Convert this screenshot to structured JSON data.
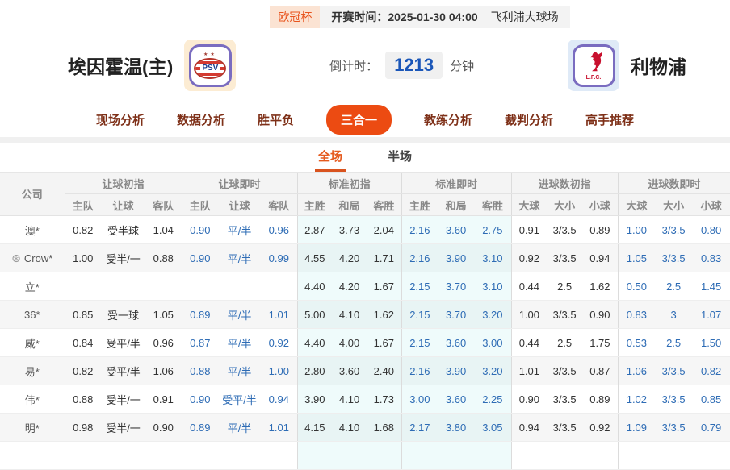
{
  "meta": {
    "league": "欧冠杯",
    "kickoff_label": "开赛时间：",
    "kickoff_time": "2025-01-30 04:00",
    "venue": "飞利浦大球场"
  },
  "header": {
    "home_team": "埃因霍温(主)",
    "away_team": "利物浦",
    "home_logo_text": "PSV",
    "home_logo_stars": "★★",
    "away_logo_text": "L.F.C.",
    "countdown_label": "倒计时：",
    "countdown_value": "1213",
    "countdown_unit": "分钟"
  },
  "nav": {
    "tabs": [
      {
        "label": "现场分析",
        "active": false
      },
      {
        "label": "数据分析",
        "active": false
      },
      {
        "label": "胜平负",
        "active": false
      },
      {
        "label": "三合一",
        "active": true
      },
      {
        "label": "教练分析",
        "active": false
      },
      {
        "label": "裁判分析",
        "active": false
      },
      {
        "label": "高手推荐",
        "active": false
      }
    ]
  },
  "subtabs": [
    {
      "label": "全场",
      "active": true
    },
    {
      "label": "半场",
      "active": false
    }
  ],
  "colors": {
    "accent_orange": "#ec4b12",
    "odds_blue": "#2e6cb5",
    "countdown_blue": "#1a56b8",
    "cyan_column_bg": "#effbfb",
    "badge_orange_text": "#e8541e"
  },
  "table": {
    "company_header": "公司",
    "groups": [
      {
        "label": "让球初指",
        "cols": [
          "主队",
          "让球",
          "客队"
        ],
        "blue": false,
        "cyan": false
      },
      {
        "label": "让球即时",
        "cols": [
          "主队",
          "让球",
          "客队"
        ],
        "blue": true,
        "cyan": false
      },
      {
        "label": "标准初指",
        "cols": [
          "主胜",
          "和局",
          "客胜"
        ],
        "blue": false,
        "cyan": true
      },
      {
        "label": "标准即时",
        "cols": [
          "主胜",
          "和局",
          "客胜"
        ],
        "blue": true,
        "cyan": true
      },
      {
        "label": "进球数初指",
        "cols": [
          "大球",
          "大小",
          "小球"
        ],
        "blue": false,
        "cyan": false
      },
      {
        "label": "进球数即时",
        "cols": [
          "大球",
          "大小",
          "小球"
        ],
        "blue": true,
        "cyan": false
      }
    ],
    "rows": [
      {
        "company": "澳*",
        "has_icon": false,
        "values": [
          [
            "0.82",
            "受半球",
            "1.04"
          ],
          [
            "0.90",
            "平/半",
            "0.96"
          ],
          [
            "2.87",
            "3.73",
            "2.04"
          ],
          [
            "2.16",
            "3.60",
            "2.75"
          ],
          [
            "0.91",
            "3/3.5",
            "0.89"
          ],
          [
            "1.00",
            "3/3.5",
            "0.80"
          ]
        ]
      },
      {
        "company": "Crow*",
        "has_icon": true,
        "values": [
          [
            "1.00",
            "受半/一",
            "0.88"
          ],
          [
            "0.90",
            "平/半",
            "0.99"
          ],
          [
            "4.55",
            "4.20",
            "1.71"
          ],
          [
            "2.16",
            "3.90",
            "3.10"
          ],
          [
            "0.92",
            "3/3.5",
            "0.94"
          ],
          [
            "1.05",
            "3/3.5",
            "0.83"
          ]
        ]
      },
      {
        "company": "立*",
        "has_icon": false,
        "values": [
          [
            "",
            "",
            ""
          ],
          [
            "",
            "",
            ""
          ],
          [
            "4.40",
            "4.20",
            "1.67"
          ],
          [
            "2.15",
            "3.70",
            "3.10"
          ],
          [
            "0.44",
            "2.5",
            "1.62"
          ],
          [
            "0.50",
            "2.5",
            "1.45"
          ]
        ]
      },
      {
        "company": "36*",
        "has_icon": false,
        "values": [
          [
            "0.85",
            "受一球",
            "1.05"
          ],
          [
            "0.89",
            "平/半",
            "1.01"
          ],
          [
            "5.00",
            "4.10",
            "1.62"
          ],
          [
            "2.15",
            "3.70",
            "3.20"
          ],
          [
            "1.00",
            "3/3.5",
            "0.90"
          ],
          [
            "0.83",
            "3",
            "1.07"
          ]
        ]
      },
      {
        "company": "威*",
        "has_icon": false,
        "values": [
          [
            "0.84",
            "受平/半",
            "0.96"
          ],
          [
            "0.87",
            "平/半",
            "0.92"
          ],
          [
            "4.40",
            "4.00",
            "1.67"
          ],
          [
            "2.15",
            "3.60",
            "3.00"
          ],
          [
            "0.44",
            "2.5",
            "1.75"
          ],
          [
            "0.53",
            "2.5",
            "1.50"
          ]
        ]
      },
      {
        "company": "易*",
        "has_icon": false,
        "values": [
          [
            "0.82",
            "受平/半",
            "1.06"
          ],
          [
            "0.88",
            "平/半",
            "1.00"
          ],
          [
            "2.80",
            "3.60",
            "2.40"
          ],
          [
            "2.16",
            "3.90",
            "3.20"
          ],
          [
            "1.01",
            "3/3.5",
            "0.87"
          ],
          [
            "1.06",
            "3/3.5",
            "0.82"
          ]
        ]
      },
      {
        "company": "伟*",
        "has_icon": false,
        "values": [
          [
            "0.88",
            "受半/一",
            "0.91"
          ],
          [
            "0.90",
            "受平/半",
            "0.94"
          ],
          [
            "3.90",
            "4.10",
            "1.73"
          ],
          [
            "3.00",
            "3.60",
            "2.25"
          ],
          [
            "0.90",
            "3/3.5",
            "0.89"
          ],
          [
            "1.02",
            "3/3.5",
            "0.85"
          ]
        ]
      },
      {
        "company": "明*",
        "has_icon": false,
        "values": [
          [
            "0.98",
            "受半/一",
            "0.90"
          ],
          [
            "0.89",
            "平/半",
            "1.01"
          ],
          [
            "4.15",
            "4.10",
            "1.68"
          ],
          [
            "2.17",
            "3.80",
            "3.05"
          ],
          [
            "0.94",
            "3/3.5",
            "0.92"
          ],
          [
            "1.09",
            "3/3.5",
            "0.79"
          ]
        ]
      }
    ]
  }
}
